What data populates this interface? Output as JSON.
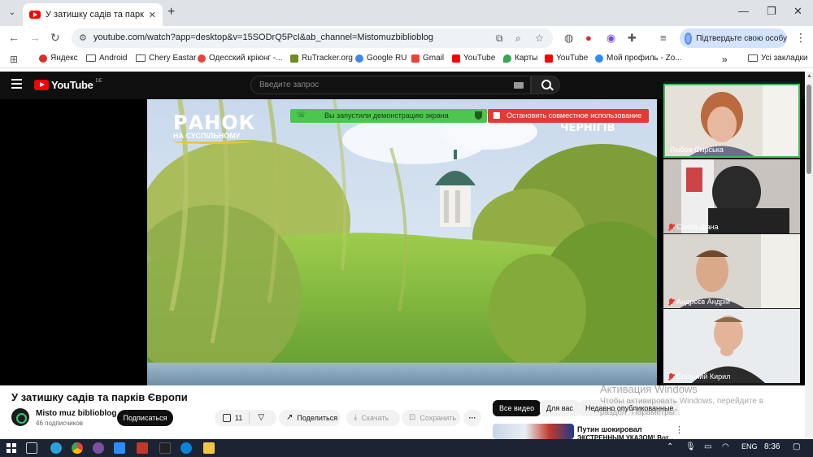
{
  "browser": {
    "tab": {
      "title": "У затишку садів та парків Євро"
    },
    "url": "youtube.com/watch?app=desktop&v=15SODrQ5PcI&ab_channel=Mistomuzbiblioblog",
    "profile_label": "Підтвердьте свою особу",
    "bookmarks": [
      {
        "label": "Яндекс",
        "color": "#d93025"
      },
      {
        "label": "Android",
        "folder": true
      },
      {
        "label": "Chery Eastar",
        "folder": true
      },
      {
        "label": "Одесский кріюнг -...",
        "color": "#e8453c"
      },
      {
        "label": "RuTracker.org",
        "color": "#6b8e23"
      },
      {
        "label": "Google RU",
        "color": "#4285f4"
      },
      {
        "label": "Gmail",
        "color": "#ea4335"
      },
      {
        "label": "YouTube",
        "color": "#ff0000"
      },
      {
        "label": "Карты",
        "color": "#34a853"
      },
      {
        "label": "YouTube",
        "color": "#ff0000"
      },
      {
        "label": "Мой профиль - Zo...",
        "color": "#2d8cff"
      }
    ],
    "bookmarks_more": "»",
    "all_bookmarks": "Усі закладки"
  },
  "youtube": {
    "logo_text": "YouTube",
    "logo_country": "DE",
    "search_placeholder": "Введите запрос",
    "video": {
      "channel_logo_big": "РАНОК",
      "channel_logo_small": "НА СУСПІЛЬНОМУ",
      "city": "ЧЕРНІГІВ"
    },
    "title": "У затишку садів та парків Європи",
    "channel": "Misto muz biblioblog",
    "subscribers": "46 подписчиков",
    "subscribe_label": "Подписаться",
    "likes": "11",
    "share_label": "Поделиться",
    "download_label": "Скачать",
    "save_label": "Сохранить",
    "more_label": "···",
    "chips": [
      "Все видео",
      "Для вас",
      "Недавно опубликованные"
    ],
    "recommended": {
      "title_line1": "Путин шокировал",
      "title_line2": "ЭКСТРЕННЫМ УКАЗОМ! Вот..."
    }
  },
  "screen_share": {
    "sharing_text": "Вы запустили демонстрацию экрана",
    "stop_label": "Остановить совместное использование"
  },
  "participants": [
    {
      "name": "Любов Скірська",
      "muted": false,
      "active": true
    },
    {
      "name": "Сахно Діана",
      "muted": true,
      "active": false
    },
    {
      "name": "Андрєєв Андрій",
      "muted": true,
      "active": false
    },
    {
      "name": "Спільний Кирил",
      "muted": true,
      "active": false
    }
  ],
  "windows_watermark": {
    "line1": "Активация Windows",
    "line2": "Чтобы активировать Windows, перейдите в",
    "line3": "раздел \"Параметры\"."
  },
  "taskbar": {
    "language": "ENG",
    "time": "8:36"
  }
}
